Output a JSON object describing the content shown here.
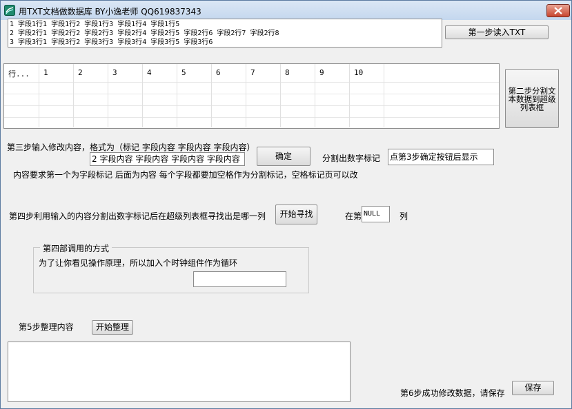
{
  "window": {
    "title": "用TXT文档做数据库  BY小逸老师 QQ619837343"
  },
  "step1": {
    "text_lines": [
      "1 字段1行1 字段1行2 字段1行3 字段1行4 字段1行5",
      "2 字段2行1 字段2行2 字段2行3 字段2行4 字段2行5 字段2行6 字段2行7 字段2行8",
      "3 字段3行1 字段3行2 字段3行3 字段3行4 字段3行5 字段3行6"
    ],
    "button": "第一步读入TXT"
  },
  "grid": {
    "columns": [
      "行...",
      "1",
      "2",
      "3",
      "4",
      "5",
      "6",
      "7",
      "8",
      "9",
      "10"
    ]
  },
  "step2": {
    "button": "第二步分割文本数据到超级列表框"
  },
  "step3": {
    "label": "第三步输入修改内容，格式为（标记 字段内容 字段内容 字段内容）",
    "input_value": "2 字段内容 字段内容 字段内容 字段内容",
    "confirm_button": "确定",
    "split_label": "分割出数字标记",
    "split_display": "点第3步确定按钮后显示",
    "note": "内容要求第一个为字段标记 后面为内容 每个字段都要加空格作为分割标记，空格标记页可以改"
  },
  "step4": {
    "label": "第四步利用输入的内容分割出数字标记后在超级列表框寻找出是哪一列",
    "find_button": "开始寻找",
    "at_label": "在第",
    "column_value": "NULL",
    "column_suffix": "列"
  },
  "group4": {
    "title": "第四部调用的方式",
    "desc": "为了让你看见操作原理，所以加入个时钟组件作为循环",
    "input_value": ""
  },
  "step5": {
    "label": "第5步整理内容",
    "organize_button": "开始整理",
    "output_text": "",
    "success_label": "第6步成功修改数据，请保存",
    "save_button": "保存"
  }
}
